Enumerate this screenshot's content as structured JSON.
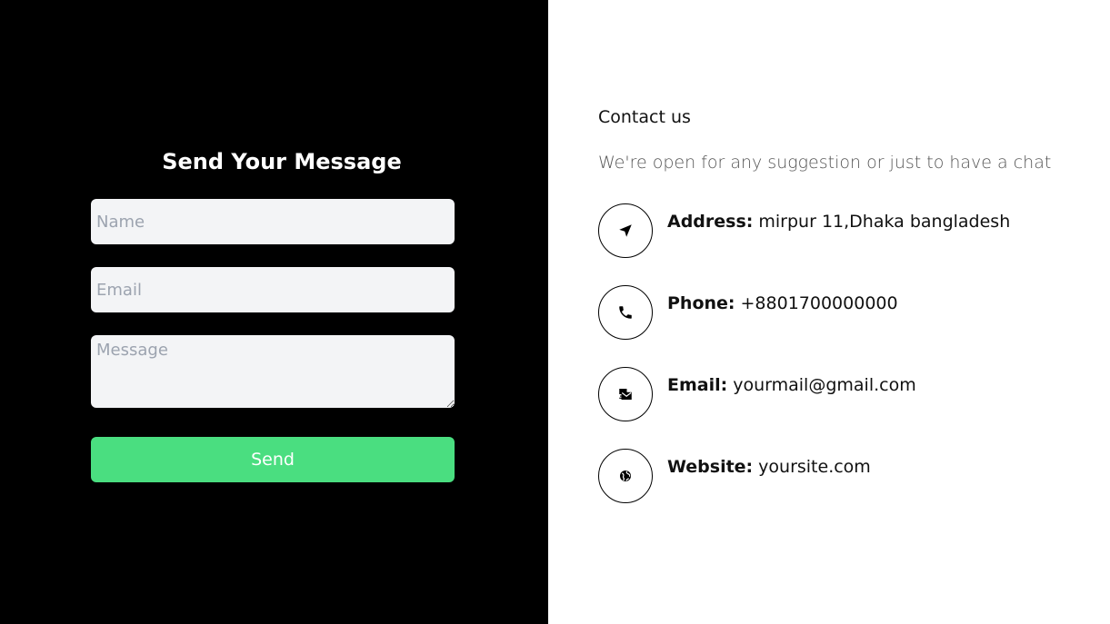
{
  "form": {
    "title": "Send Your Message",
    "name_placeholder": "Name",
    "email_placeholder": "Email",
    "message_placeholder": "Message",
    "send_label": "Send"
  },
  "contact": {
    "heading": "Contact us",
    "subheading": "We're open for any suggestion or just to have a chat",
    "items": [
      {
        "label": "Address:",
        "value": "mirpur 11,Dhaka bangladesh",
        "icon": "location-arrow-icon"
      },
      {
        "label": "Phone:",
        "value": "+8801700000000",
        "icon": "phone-icon"
      },
      {
        "label": "Email:",
        "value": "yourmail@gmail.com",
        "icon": "mail-bulk-icon"
      },
      {
        "label": "Website:",
        "value": "yoursite.com",
        "icon": "globe-icon"
      }
    ]
  },
  "colors": {
    "left_bg": "#000000",
    "right_bg": "#ffffff",
    "input_bg": "#f3f4f6",
    "button_bg": "#4ade80"
  }
}
